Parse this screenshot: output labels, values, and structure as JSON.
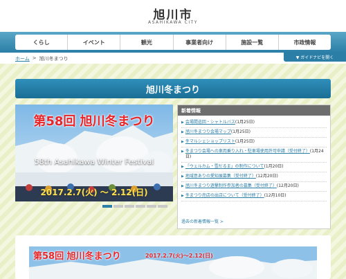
{
  "header": {
    "logo_jp": "旭川市",
    "logo_en": "ASAHIKAWA CITY"
  },
  "nav": {
    "items": [
      "くらし",
      "イベント",
      "観光",
      "事業者向け",
      "施設一覧",
      "市政情報"
    ]
  },
  "breadcrumb": {
    "home": "ホーム",
    "separator": ">",
    "current": "旭川冬まつり"
  },
  "guide_button": "▼ ガイドナビを開く",
  "page_title": "旭川冬まつり",
  "slideshow": {
    "title": "第58回 旭川冬まつり",
    "subtitle": "58th Asahikawa Winter Festival",
    "date": "2017.2.7(火) ～ 2.12(日)",
    "slide_count": 6,
    "active_index": 0
  },
  "news": {
    "heading": "新着情報",
    "items": [
      {
        "text": "会場間巡回・シャトルバス",
        "date": "(1月25日)"
      },
      {
        "text": "旭川冬まつり会場マップ",
        "date": "(1月25日)"
      },
      {
        "text": "冬マルシェショップリスト",
        "date": "(1月25日)"
      },
      {
        "text": "冬まつり会場への車両乗り入れ・駐車場使用許可申請（受付終了）",
        "date": "(1月24日)"
      },
      {
        "text": "「ウェルカム・雪だるま」の制作について",
        "date": "(1月20日)"
      },
      {
        "text": "地域意ありの愛知展募集（受付終了）",
        "date": "(12月20日)"
      },
      {
        "text": "旭川冬まつり遊撃制作参加者の募集（受付終了）",
        "date": "(12月20日)"
      },
      {
        "text": "冬まつり売店の出店について（受付終了）",
        "date": "(12月10日)"
      }
    ],
    "more_link": "過去の新着情報一覧 >"
  },
  "banner": {
    "title": "第58回 旭川冬まつり",
    "date": "2017.2.7(火)～2.12(日)"
  },
  "colors": {
    "accent": "#2b7ea6",
    "festival_red": "#e8262a",
    "date_yellow": "#ffe14a"
  }
}
